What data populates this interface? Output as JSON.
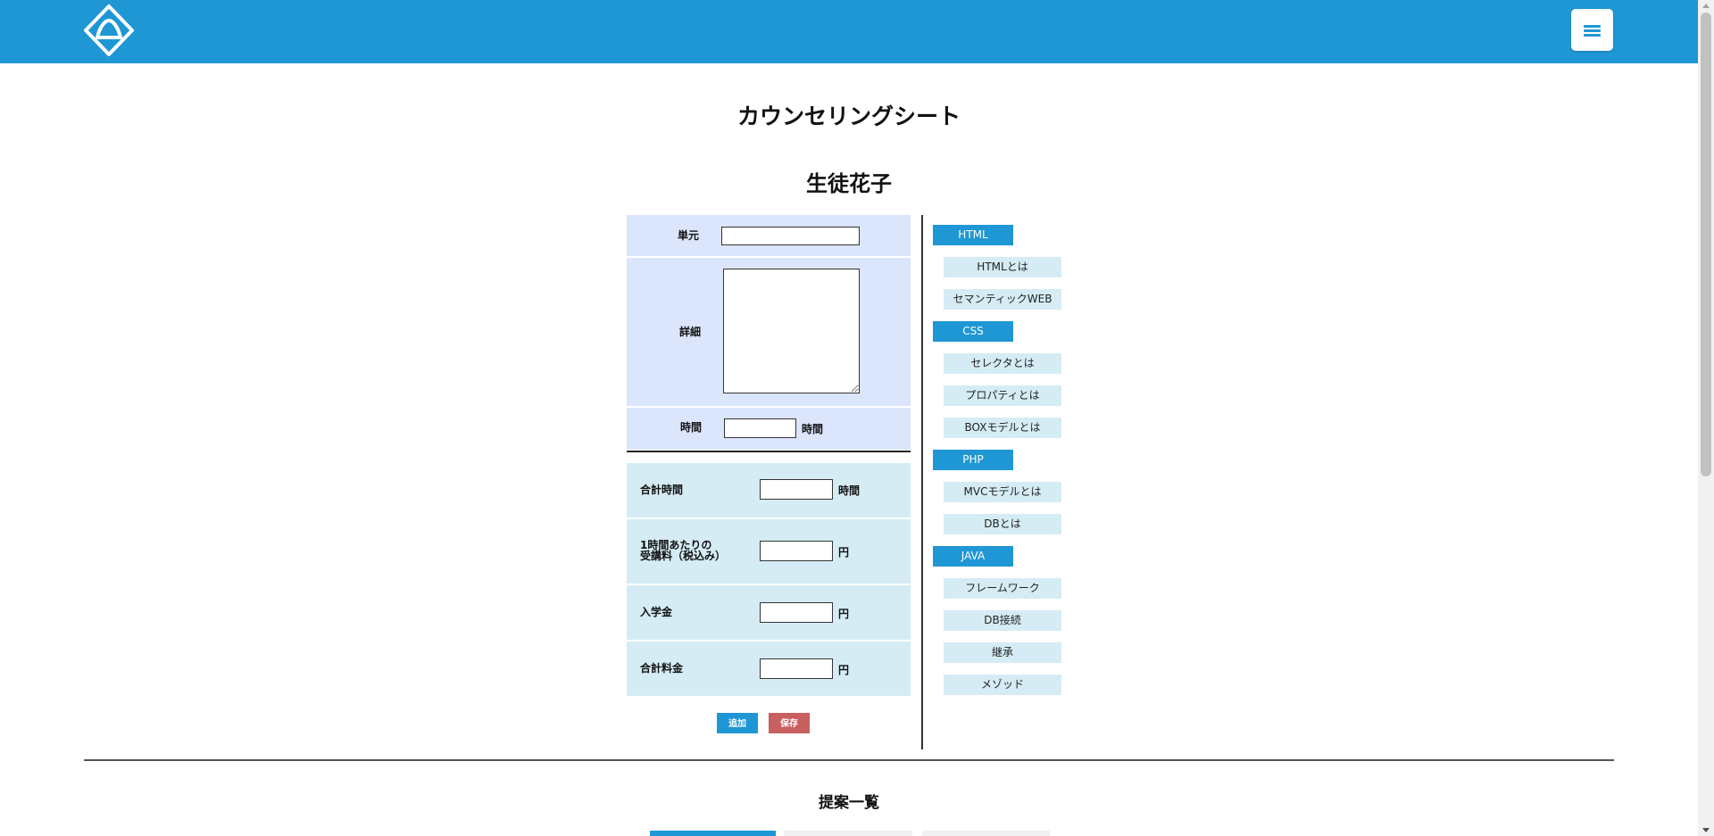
{
  "page": {
    "title": "カウンセリングシート",
    "student_name": "生徒花子",
    "list_title": "提案一覧"
  },
  "form": {
    "unit_label": "単元",
    "unit_value": "",
    "detail_label": "詳細",
    "detail_value": "",
    "time_label": "時間",
    "time_value": "",
    "time_unit": "時間",
    "total_time_label": "合計時間",
    "total_time_value": "",
    "total_time_unit": "時間",
    "hourly_fee_label_line1": "1時間あたりの",
    "hourly_fee_label_line2": "受講料（税込み）",
    "hourly_fee_value": "",
    "hourly_fee_unit": "円",
    "admission_label": "入学金",
    "admission_value": "",
    "admission_unit": "円",
    "total_fee_label": "合計料金",
    "total_fee_value": "",
    "total_fee_unit": "円",
    "add_button": "追加",
    "save_button": "保存"
  },
  "sidebar": {
    "categories": [
      {
        "name": "HTML",
        "items": [
          "HTMLとは",
          "セマンティックWEB"
        ]
      },
      {
        "name": "CSS",
        "items": [
          "セレクタとは",
          "プロパティとは",
          "BOXモデルとは"
        ]
      },
      {
        "name": "PHP",
        "items": [
          "MVCモデルとは",
          "DBとは"
        ]
      },
      {
        "name": "JAVA",
        "items": [
          "フレームワーク",
          "DB接続",
          "継承",
          "メゾッド"
        ]
      }
    ]
  },
  "colors": {
    "header": "#1f97d4",
    "form_top_bg": "#dbe5fc",
    "form_bottom_bg": "#d5ecf5",
    "add_button": "#1f97d4",
    "save_button": "#c96060",
    "category_bg": "#1f97d4",
    "item_bg": "#d5ecf5"
  },
  "icons": {
    "logo": "diamond-logo-icon",
    "menu": "hamburger-menu-icon"
  }
}
